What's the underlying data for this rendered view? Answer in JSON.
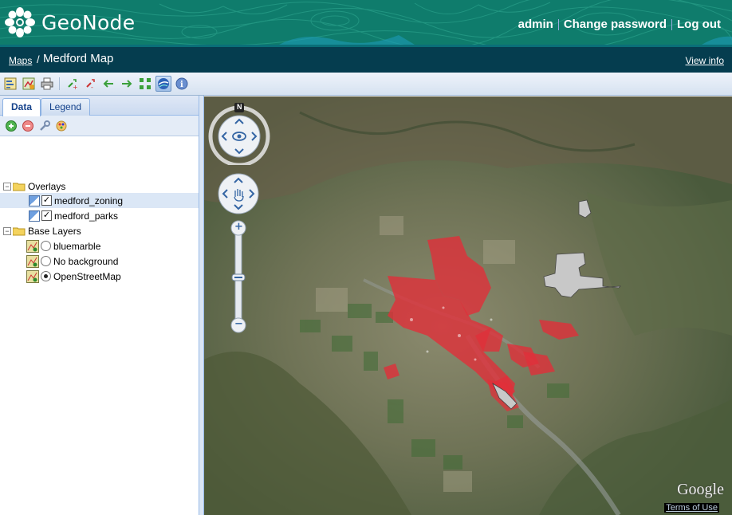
{
  "header": {
    "logo_text": "GeoNode",
    "user_links": [
      "admin",
      "Change password",
      "Log out"
    ]
  },
  "breadcrumb": {
    "maps_link": "Maps",
    "separator": "/",
    "title": "Medford Map",
    "view_info": "View info"
  },
  "toolbar": {
    "icons": [
      "layer-properties-icon",
      "add-layer-icon",
      "print-icon",
      "zoom-in-icon",
      "zoom-out-icon",
      "back-icon",
      "forward-icon",
      "zoom-extent-icon",
      "google-earth-icon",
      "info-icon"
    ]
  },
  "panel": {
    "tabs": [
      "Data",
      "Legend"
    ],
    "active_tab": "Data",
    "tree": {
      "overlays_label": "Overlays",
      "overlays": [
        {
          "label": "medford_zoning",
          "checked": true
        },
        {
          "label": "medford_parks",
          "checked": true
        }
      ],
      "base_label": "Base Layers",
      "base_layers": [
        {
          "label": "bluemarble",
          "selected": false
        },
        {
          "label": "No background",
          "selected": false
        },
        {
          "label": "OpenStreetMap",
          "selected": true
        }
      ]
    }
  },
  "map": {
    "north_label": "N",
    "zoom_in": "+",
    "zoom_out": "−",
    "attribution": "Google",
    "terms": "Terms of Use"
  },
  "colors": {
    "header_bg": "#0d7a6a",
    "crumb_bg": "#053d4f",
    "zoning": "#e0303a"
  }
}
